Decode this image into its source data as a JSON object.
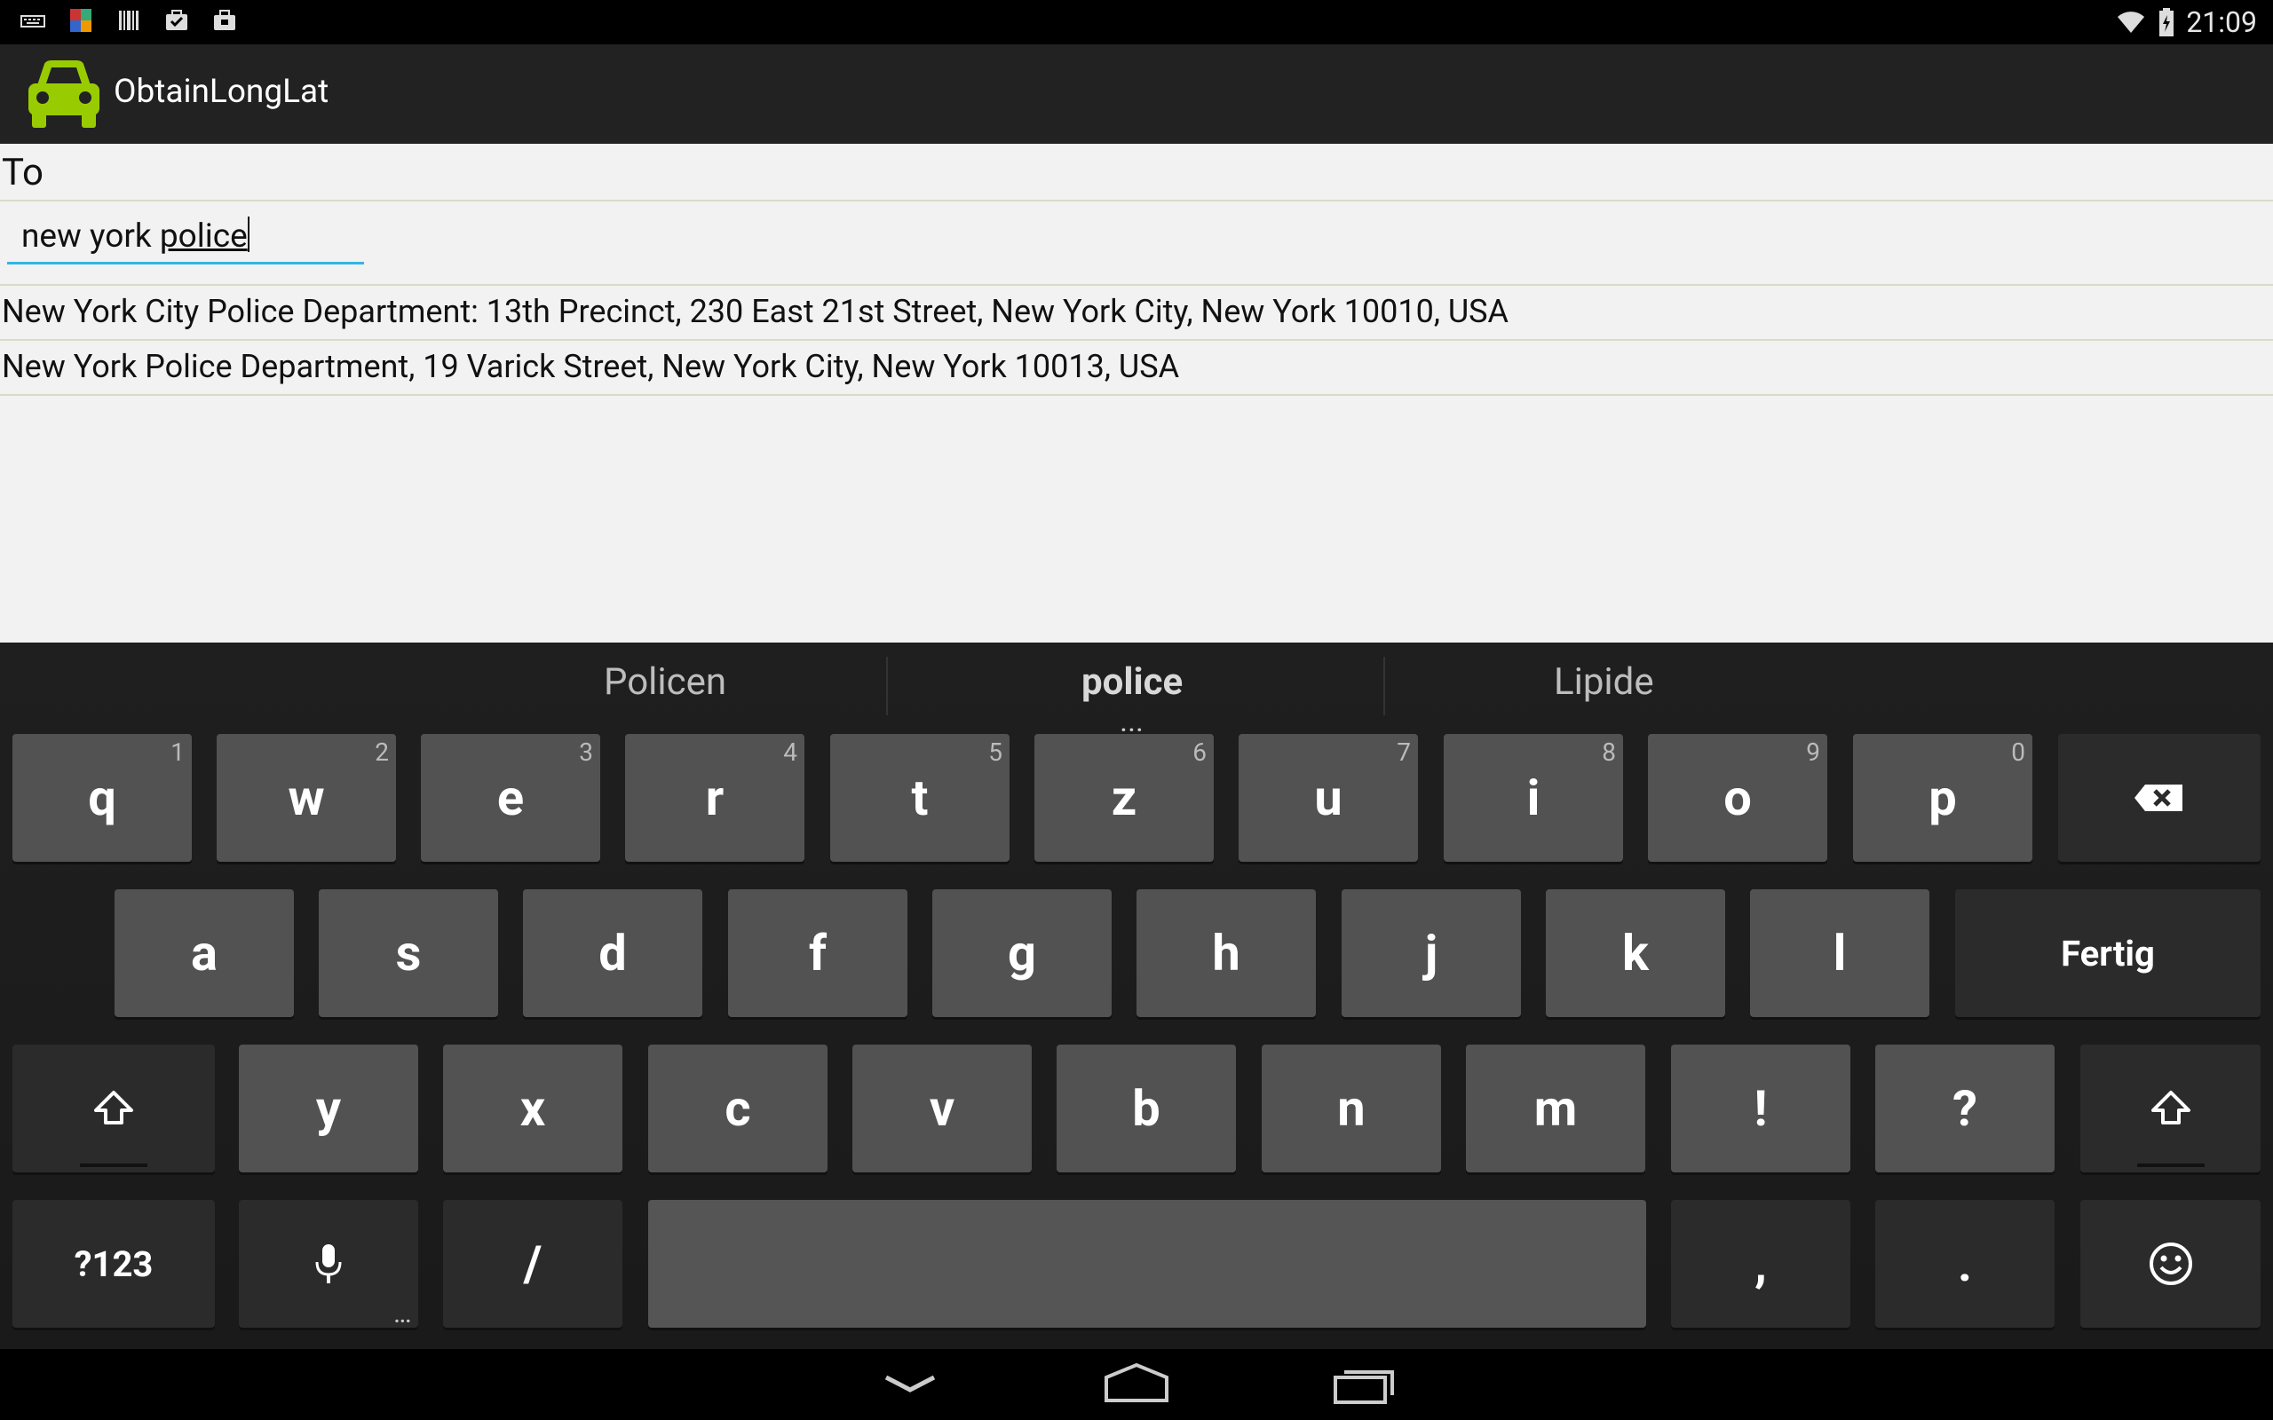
{
  "status_bar": {
    "time": "21:09",
    "icons_left": [
      "keyboard-icon",
      "app-icon",
      "barcode-icon",
      "task-icon",
      "bag-icon"
    ],
    "icons_right": [
      "wifi-icon",
      "battery-icon"
    ]
  },
  "action_bar": {
    "title": "ObtainLongLat",
    "icon": "car-icon"
  },
  "form": {
    "to_label": "To",
    "query_prefix": "new york ",
    "query_composing": "police",
    "results": [
      "New York City Police Department: 13th Precinct, 230 East 21st Street, New York City, New York 10010, USA",
      "New York Police Department, 19 Varick Street, New York City, New York 10013, USA"
    ]
  },
  "keyboard": {
    "suggestions": [
      "Policen",
      "police",
      "Lipide"
    ],
    "suggestion_more": "...",
    "row1": [
      {
        "label": "q",
        "hint": "1"
      },
      {
        "label": "w",
        "hint": "2"
      },
      {
        "label": "e",
        "hint": "3"
      },
      {
        "label": "r",
        "hint": "4"
      },
      {
        "label": "t",
        "hint": "5"
      },
      {
        "label": "z",
        "hint": "6"
      },
      {
        "label": "u",
        "hint": "7"
      },
      {
        "label": "i",
        "hint": "8"
      },
      {
        "label": "o",
        "hint": "9"
      },
      {
        "label": "p",
        "hint": "0"
      }
    ],
    "row2": [
      "a",
      "s",
      "d",
      "f",
      "g",
      "h",
      "j",
      "k",
      "l"
    ],
    "done_label": "Fertig",
    "row3": [
      "y",
      "x",
      "c",
      "v",
      "b",
      "n",
      "m",
      "!",
      "?"
    ],
    "symbols_label": "?123",
    "slash_label": "/",
    "comma_label": ",",
    "period_label": ".",
    "mic_more": "..."
  },
  "nav_bar": {
    "buttons": [
      "back-icon",
      "home-icon",
      "recents-icon"
    ]
  }
}
